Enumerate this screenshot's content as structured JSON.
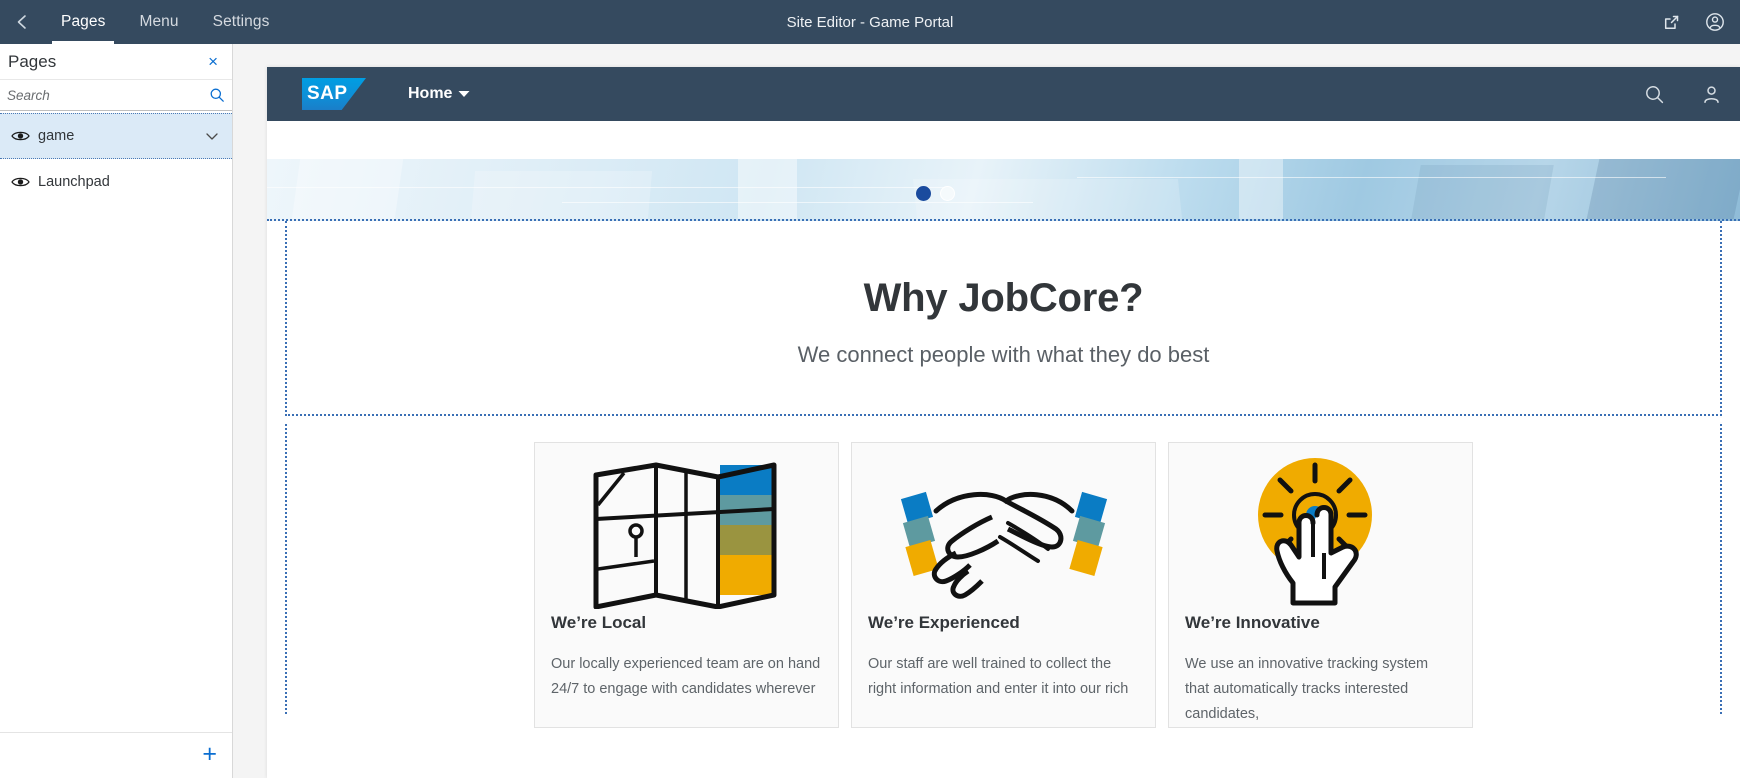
{
  "shell": {
    "back_icon": "chevron-left-icon",
    "tabs": [
      {
        "label": "Pages",
        "active": true
      },
      {
        "label": "Menu",
        "active": false
      },
      {
        "label": "Settings",
        "active": false
      }
    ],
    "title": "Site Editor - Game Portal",
    "actions": [
      {
        "icon": "open-in-new-window-icon"
      },
      {
        "icon": "user-account-icon"
      }
    ],
    "bg_color": "#354a5f"
  },
  "sidebar": {
    "title": "Pages",
    "close_label": "×",
    "search": {
      "placeholder": "Search",
      "value": "",
      "icon": "search-icon"
    },
    "items": [
      {
        "label": "game",
        "icon": "eye-icon",
        "selected": true,
        "expander": "chevron-down-icon"
      },
      {
        "label": "Launchpad",
        "icon": "eye-icon",
        "selected": false
      }
    ],
    "add_label": "+",
    "selected_bg": "#dbeaf7",
    "accent_color": "#0a6ed1"
  },
  "site": {
    "logo_text": "SAP",
    "nav": {
      "label": "Home",
      "caret": "caret-down-icon"
    },
    "header_actions": [
      {
        "icon": "search-icon"
      },
      {
        "icon": "person-icon"
      }
    ],
    "banner": {
      "dots": [
        {
          "state": "active"
        },
        {
          "state": "inactive"
        }
      ]
    },
    "intro": {
      "title": "Why JobCore?",
      "subtitle": "We connect people with what they do best"
    },
    "cards": [
      {
        "art": "folded-map-icon",
        "title": "We’re Local",
        "body": "Our locally experienced team are on hand 24/7 to engage with candidates wherever"
      },
      {
        "art": "handshake-icon",
        "title": "We’re Experienced",
        "body": "Our staff are well trained to collect the right information and enter it into our rich"
      },
      {
        "art": "pointing-hand-icon",
        "title": "We’re Innovative",
        "body": "We use an innovative tracking system that automatically tracks interested candidates,"
      }
    ]
  },
  "colors": {
    "shell": "#354a5f",
    "accent": "#0a6ed1",
    "dot_active": "#1a4b9e",
    "heading": "#32363a",
    "gold": "#f0ab00",
    "map_blue": "#0a7cc4",
    "map_teal": "#5e9aa0",
    "map_olive": "#9a9440"
  }
}
